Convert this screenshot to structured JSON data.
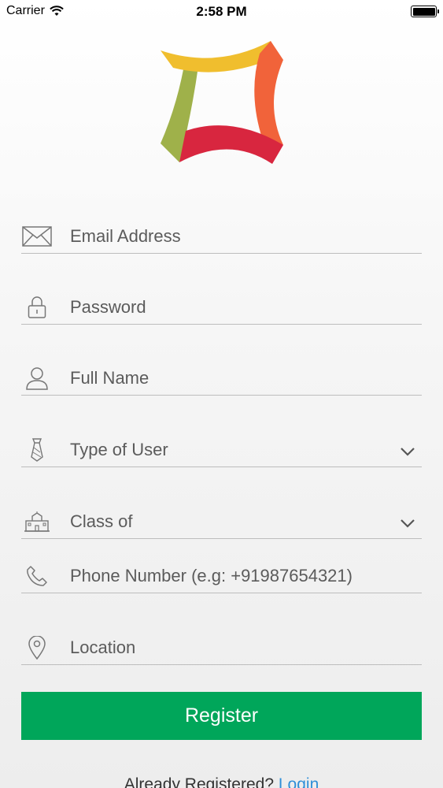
{
  "status_bar": {
    "carrier": "Carrier",
    "time": "2:58 PM"
  },
  "brand": {
    "colors": {
      "yellow": "#f0be2e",
      "orange": "#f1633a",
      "red": "#d8263f",
      "olive": "#9fb14a"
    }
  },
  "form": {
    "email": {
      "placeholder": "Email Address",
      "icon": "envelope-icon"
    },
    "password": {
      "placeholder": "Password",
      "icon": "lock-icon"
    },
    "full_name": {
      "placeholder": "Full Name",
      "icon": "user-icon"
    },
    "user_type": {
      "label": "Type of User",
      "icon": "tie-icon"
    },
    "class_of": {
      "label": "Class of",
      "icon": "school-icon"
    },
    "phone": {
      "placeholder": "Phone Number (e.g: +91987654321)",
      "icon": "phone-icon"
    },
    "location": {
      "placeholder": "Location",
      "icon": "location-pin-icon"
    }
  },
  "register_label": "Register",
  "footer": {
    "prompt": "Already Registered?",
    "link": "Login"
  },
  "colors": {
    "primary": "#00a65a",
    "link": "#2f8fd8",
    "divider": "#bdbdbd"
  }
}
